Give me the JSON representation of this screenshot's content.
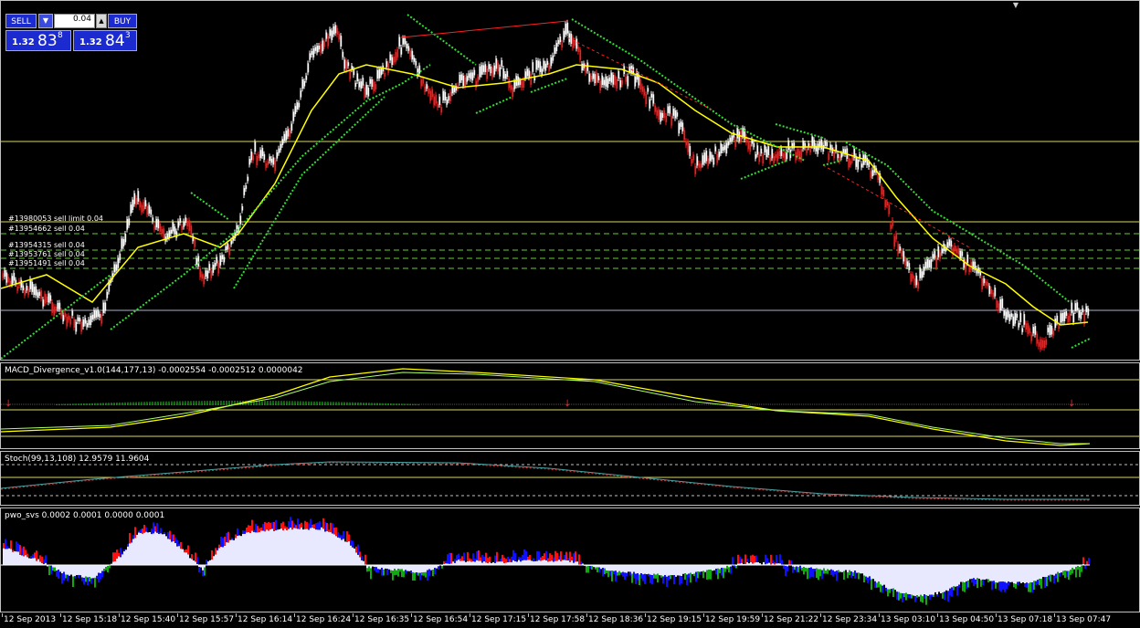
{
  "one_click": {
    "sell_label": "SELL",
    "buy_label": "BUY",
    "lot_dropdown": "▼",
    "lot_value": "0.04",
    "lot_up": "▲",
    "bid_small": "1.32",
    "bid_big": "83",
    "bid_sup": "8",
    "ask_small": "1.32",
    "ask_big": "84",
    "ask_sup": "3"
  },
  "orders": [
    "#13980053 sell limit 0.04",
    "#13954662 sell 0.04",
    "#13954315 sell 0.04",
    "#13953761 sell 0.04",
    "#13951491 sell 0.04"
  ],
  "indicators": {
    "macd_label": "MACD_Divergence_v1.0(144,177,13) -0.0002554 -0.0002512 0.0000042",
    "stoch_label": "Stoch(99,13,108) 12.9579 11.9604",
    "pwo_label": "pwo_svs 0.0002 0.0001 0.0000 0.0001"
  },
  "time_axis": [
    "12 Sep 2013",
    "12 Sep 15:18",
    "12 Sep 15:40",
    "12 Sep 15:57",
    "12 Sep 16:14",
    "12 Sep 16:24",
    "12 Sep 16:35",
    "12 Sep 16:54",
    "12 Sep 17:15",
    "12 Sep 17:58",
    "12 Sep 18:36",
    "12 Sep 19:15",
    "12 Sep 19:59",
    "12 Sep 21:22",
    "12 Sep 23:34",
    "13 Sep 03:10",
    "13 Sep 04:50",
    "13 Sep 07:18",
    "13 Sep 07:47"
  ],
  "colors": {
    "bull_candle": "#ffffff",
    "bear_candle": "#ff1a1a",
    "ma_line": "#ffff00",
    "dotted_ma": "#33dd33",
    "level_line": "#ffff66",
    "order_line": "#66cc33",
    "pwo_blue": "#1010ff",
    "pwo_red": "#ff1010",
    "pwo_green": "#10aa10",
    "pwo_white": "#e8e8ff"
  }
}
